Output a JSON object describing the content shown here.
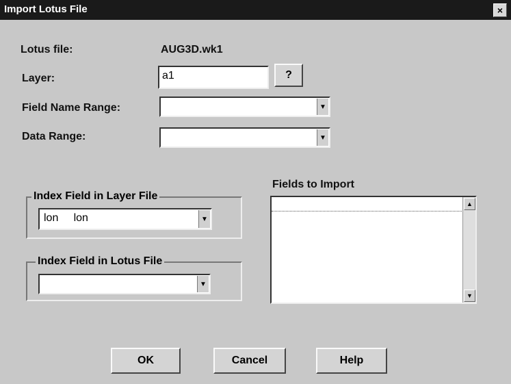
{
  "window": {
    "title": "Import Lotus File",
    "close_glyph": "×"
  },
  "form": {
    "lotus_file_label": "Lotus file:",
    "lotus_file_value": "AUG3D.wk1",
    "layer_label": "Layer:",
    "layer_value": "a1",
    "layer_help_label": "?",
    "field_name_range_label": "Field Name Range:",
    "field_name_range_value": "",
    "data_range_label": "Data Range:",
    "data_range_value": ""
  },
  "index_layer": {
    "label": "Index Field in Layer File",
    "value": "lon     lon"
  },
  "index_lotus": {
    "label": "Index Field in Lotus File",
    "value": ""
  },
  "fields_to_import": {
    "label": "Fields to Import",
    "items": []
  },
  "buttons": {
    "ok": "OK",
    "cancel": "Cancel",
    "help": "Help"
  },
  "icons": {
    "dropdown": "▼",
    "scroll_up": "▲",
    "scroll_down": "▼"
  }
}
